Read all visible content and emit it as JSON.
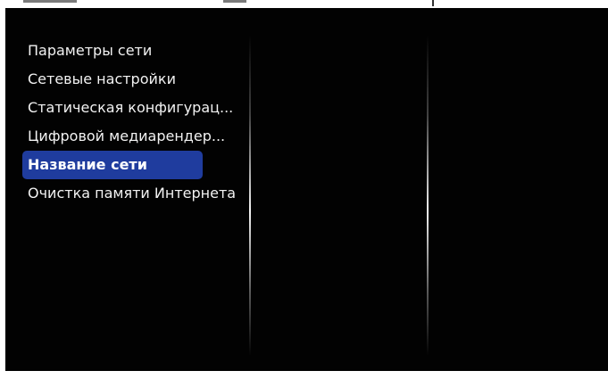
{
  "menu": {
    "items": [
      {
        "label": "Параметры сети",
        "selected": false
      },
      {
        "label": "Сетевые настройки",
        "selected": false
      },
      {
        "label": "Статическая конфигурац...",
        "selected": false
      },
      {
        "label": "Цифровой медиарендер...",
        "selected": false
      },
      {
        "label": "Название сети",
        "selected": true
      },
      {
        "label": "Очистка памяти Интернета",
        "selected": false
      }
    ]
  },
  "colors": {
    "background": "#020202",
    "highlight": "#1f3c9e",
    "text": "#f2f2f2"
  }
}
